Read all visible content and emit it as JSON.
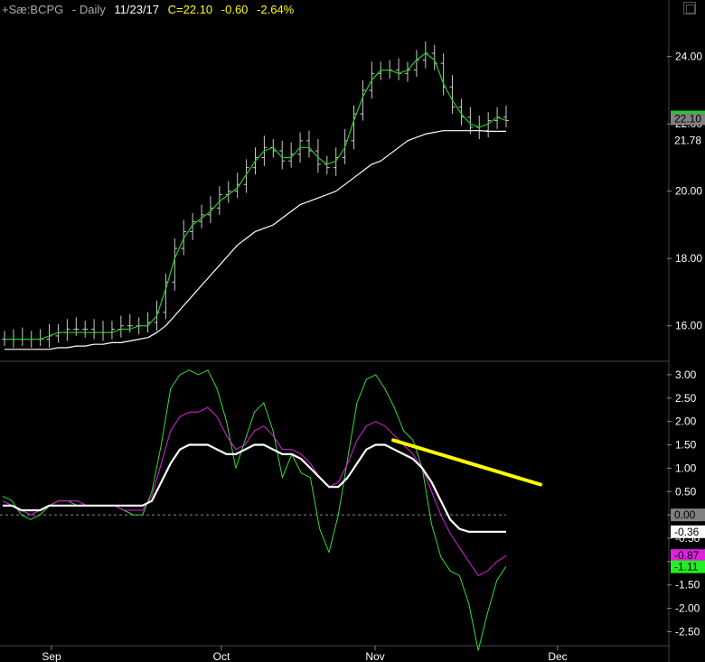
{
  "header": {
    "symbol": "+Sæ:BCPG",
    "period": "- Daily",
    "date": "11/23/17",
    "close": "C=22.10",
    "change": "-0.60",
    "change_pct": "-2.64%"
  },
  "colors": {
    "background": "#000000",
    "price_bar": "#c8c8c8",
    "ma_fast": "#22cc22",
    "ma_slow": "#ffffff",
    "osc_green": "#33dd33",
    "osc_magenta": "#dd22dd",
    "osc_white": "#ffffff",
    "trendline": "#ffff00",
    "header_text": "#ffffff",
    "header_value": "#ffff00"
  },
  "chart_data": [
    {
      "type": "line",
      "panel": "price",
      "yticks": [
        "24.00",
        "22.00",
        "20.00",
        "18.00",
        "16.00"
      ],
      "ylim": [
        15.0,
        25.2
      ],
      "last_price_tag": "22.10",
      "ma_tag": "21.78",
      "series": [
        {
          "key": "close",
          "values": [
            15.6,
            15.6,
            15.6,
            15.6,
            15.6,
            15.7,
            15.8,
            15.9,
            15.9,
            15.9,
            15.8,
            15.8,
            15.9,
            16.0,
            16.0,
            16.0,
            16.1,
            16.4,
            17.3,
            18.3,
            18.8,
            19.1,
            19.3,
            19.5,
            19.9,
            20.0,
            20.2,
            20.7,
            21.0,
            21.3,
            21.2,
            20.9,
            21.1,
            21.5,
            21.2,
            20.8,
            20.7,
            21.0,
            21.5,
            22.3,
            23.0,
            23.5,
            23.6,
            23.6,
            23.5,
            23.6,
            23.9,
            24.1,
            23.8,
            23.1,
            22.5,
            22.2,
            21.9,
            21.8,
            22.1,
            22.2,
            22.1
          ]
        },
        {
          "key": "ma_fast",
          "values": [
            15.6,
            15.6,
            15.6,
            15.6,
            15.6,
            15.7,
            15.8,
            15.8,
            15.8,
            15.8,
            15.8,
            15.8,
            15.8,
            15.9,
            15.9,
            16.0,
            16.0,
            16.3,
            17.1,
            18.0,
            18.6,
            19.0,
            19.2,
            19.4,
            19.7,
            19.9,
            20.1,
            20.5,
            20.9,
            21.2,
            21.3,
            21.0,
            21.0,
            21.3,
            21.3,
            21.0,
            20.8,
            20.9,
            21.3,
            22.1,
            22.8,
            23.3,
            23.6,
            23.6,
            23.5,
            23.6,
            23.9,
            24.1,
            23.9,
            23.2,
            22.7,
            22.3,
            22.0,
            21.9,
            22.0,
            22.2,
            22.1
          ]
        },
        {
          "key": "ma_slow",
          "values": [
            15.3,
            15.3,
            15.3,
            15.3,
            15.3,
            15.3,
            15.35,
            15.35,
            15.4,
            15.4,
            15.45,
            15.45,
            15.5,
            15.5,
            15.55,
            15.6,
            15.65,
            15.8,
            16.0,
            16.3,
            16.6,
            16.9,
            17.2,
            17.5,
            17.8,
            18.1,
            18.4,
            18.6,
            18.8,
            18.9,
            19.0,
            19.2,
            19.4,
            19.6,
            19.7,
            19.8,
            19.9,
            20.0,
            20.2,
            20.4,
            20.6,
            20.8,
            20.9,
            21.1,
            21.3,
            21.5,
            21.6,
            21.7,
            21.75,
            21.8,
            21.8,
            21.8,
            21.8,
            21.8,
            21.78,
            21.78,
            21.78
          ]
        }
      ]
    },
    {
      "type": "line",
      "panel": "oscillator",
      "yticks": [
        "3.00",
        "2.50",
        "2.00",
        "1.50",
        "1.00",
        "0.50",
        "0.00",
        "-0.50",
        "-1.00",
        "-1.50",
        "-2.00",
        "-2.50"
      ],
      "ylim": [
        -2.8,
        3.25
      ],
      "zero_tag": "0.00",
      "white_tag": "-0.36",
      "magenta_tag": "-0.87",
      "green_tag": "-1.11",
      "series": [
        {
          "key": "osc_green",
          "values": [
            0.4,
            0.3,
            0.0,
            -0.1,
            0.0,
            0.2,
            0.3,
            0.3,
            0.2,
            0.2,
            0.2,
            0.2,
            0.2,
            0.1,
            0.0,
            0.0,
            0.5,
            1.5,
            2.7,
            3.0,
            3.1,
            3.0,
            3.1,
            2.7,
            2.0,
            1.0,
            1.6,
            2.2,
            2.4,
            1.8,
            0.8,
            1.3,
            0.9,
            0.8,
            -0.3,
            -0.8,
            0.0,
            1.2,
            2.4,
            2.9,
            3.0,
            2.7,
            2.3,
            1.8,
            1.6,
            1.0,
            -0.2,
            -0.9,
            -1.2,
            -1.3,
            -1.9,
            -2.9,
            -2.1,
            -1.4,
            -1.1
          ]
        },
        {
          "key": "osc_magenta",
          "values": [
            0.3,
            0.2,
            0.1,
            0.0,
            0.1,
            0.2,
            0.3,
            0.3,
            0.3,
            0.2,
            0.2,
            0.2,
            0.2,
            0.1,
            0.1,
            0.1,
            0.4,
            1.1,
            1.8,
            2.1,
            2.2,
            2.2,
            2.3,
            2.1,
            1.7,
            1.4,
            1.5,
            1.8,
            1.9,
            1.7,
            1.4,
            1.4,
            1.3,
            1.1,
            0.8,
            0.6,
            0.7,
            1.1,
            1.6,
            1.9,
            2.0,
            1.9,
            1.7,
            1.5,
            1.3,
            1.0,
            0.5,
            0.0,
            -0.4,
            -0.7,
            -1.0,
            -1.3,
            -1.2,
            -1.0,
            -0.87
          ]
        },
        {
          "key": "osc_white",
          "values": [
            0.2,
            0.2,
            0.1,
            0.1,
            0.1,
            0.2,
            0.2,
            0.2,
            0.2,
            0.2,
            0.2,
            0.2,
            0.2,
            0.2,
            0.2,
            0.2,
            0.3,
            0.7,
            1.1,
            1.4,
            1.5,
            1.5,
            1.5,
            1.4,
            1.3,
            1.3,
            1.4,
            1.5,
            1.5,
            1.4,
            1.3,
            1.3,
            1.2,
            1.0,
            0.8,
            0.6,
            0.6,
            0.8,
            1.1,
            1.4,
            1.5,
            1.5,
            1.4,
            1.3,
            1.2,
            1.0,
            0.7,
            0.3,
            -0.1,
            -0.3,
            -0.36,
            -0.36,
            -0.36,
            -0.36,
            -0.36
          ]
        },
        {
          "key": "trendline",
          "values": [
            1.6,
            0.65
          ]
        }
      ]
    }
  ],
  "x_axis": {
    "labels": [
      "Sep",
      "Oct",
      "Nov",
      "Dec"
    ]
  }
}
